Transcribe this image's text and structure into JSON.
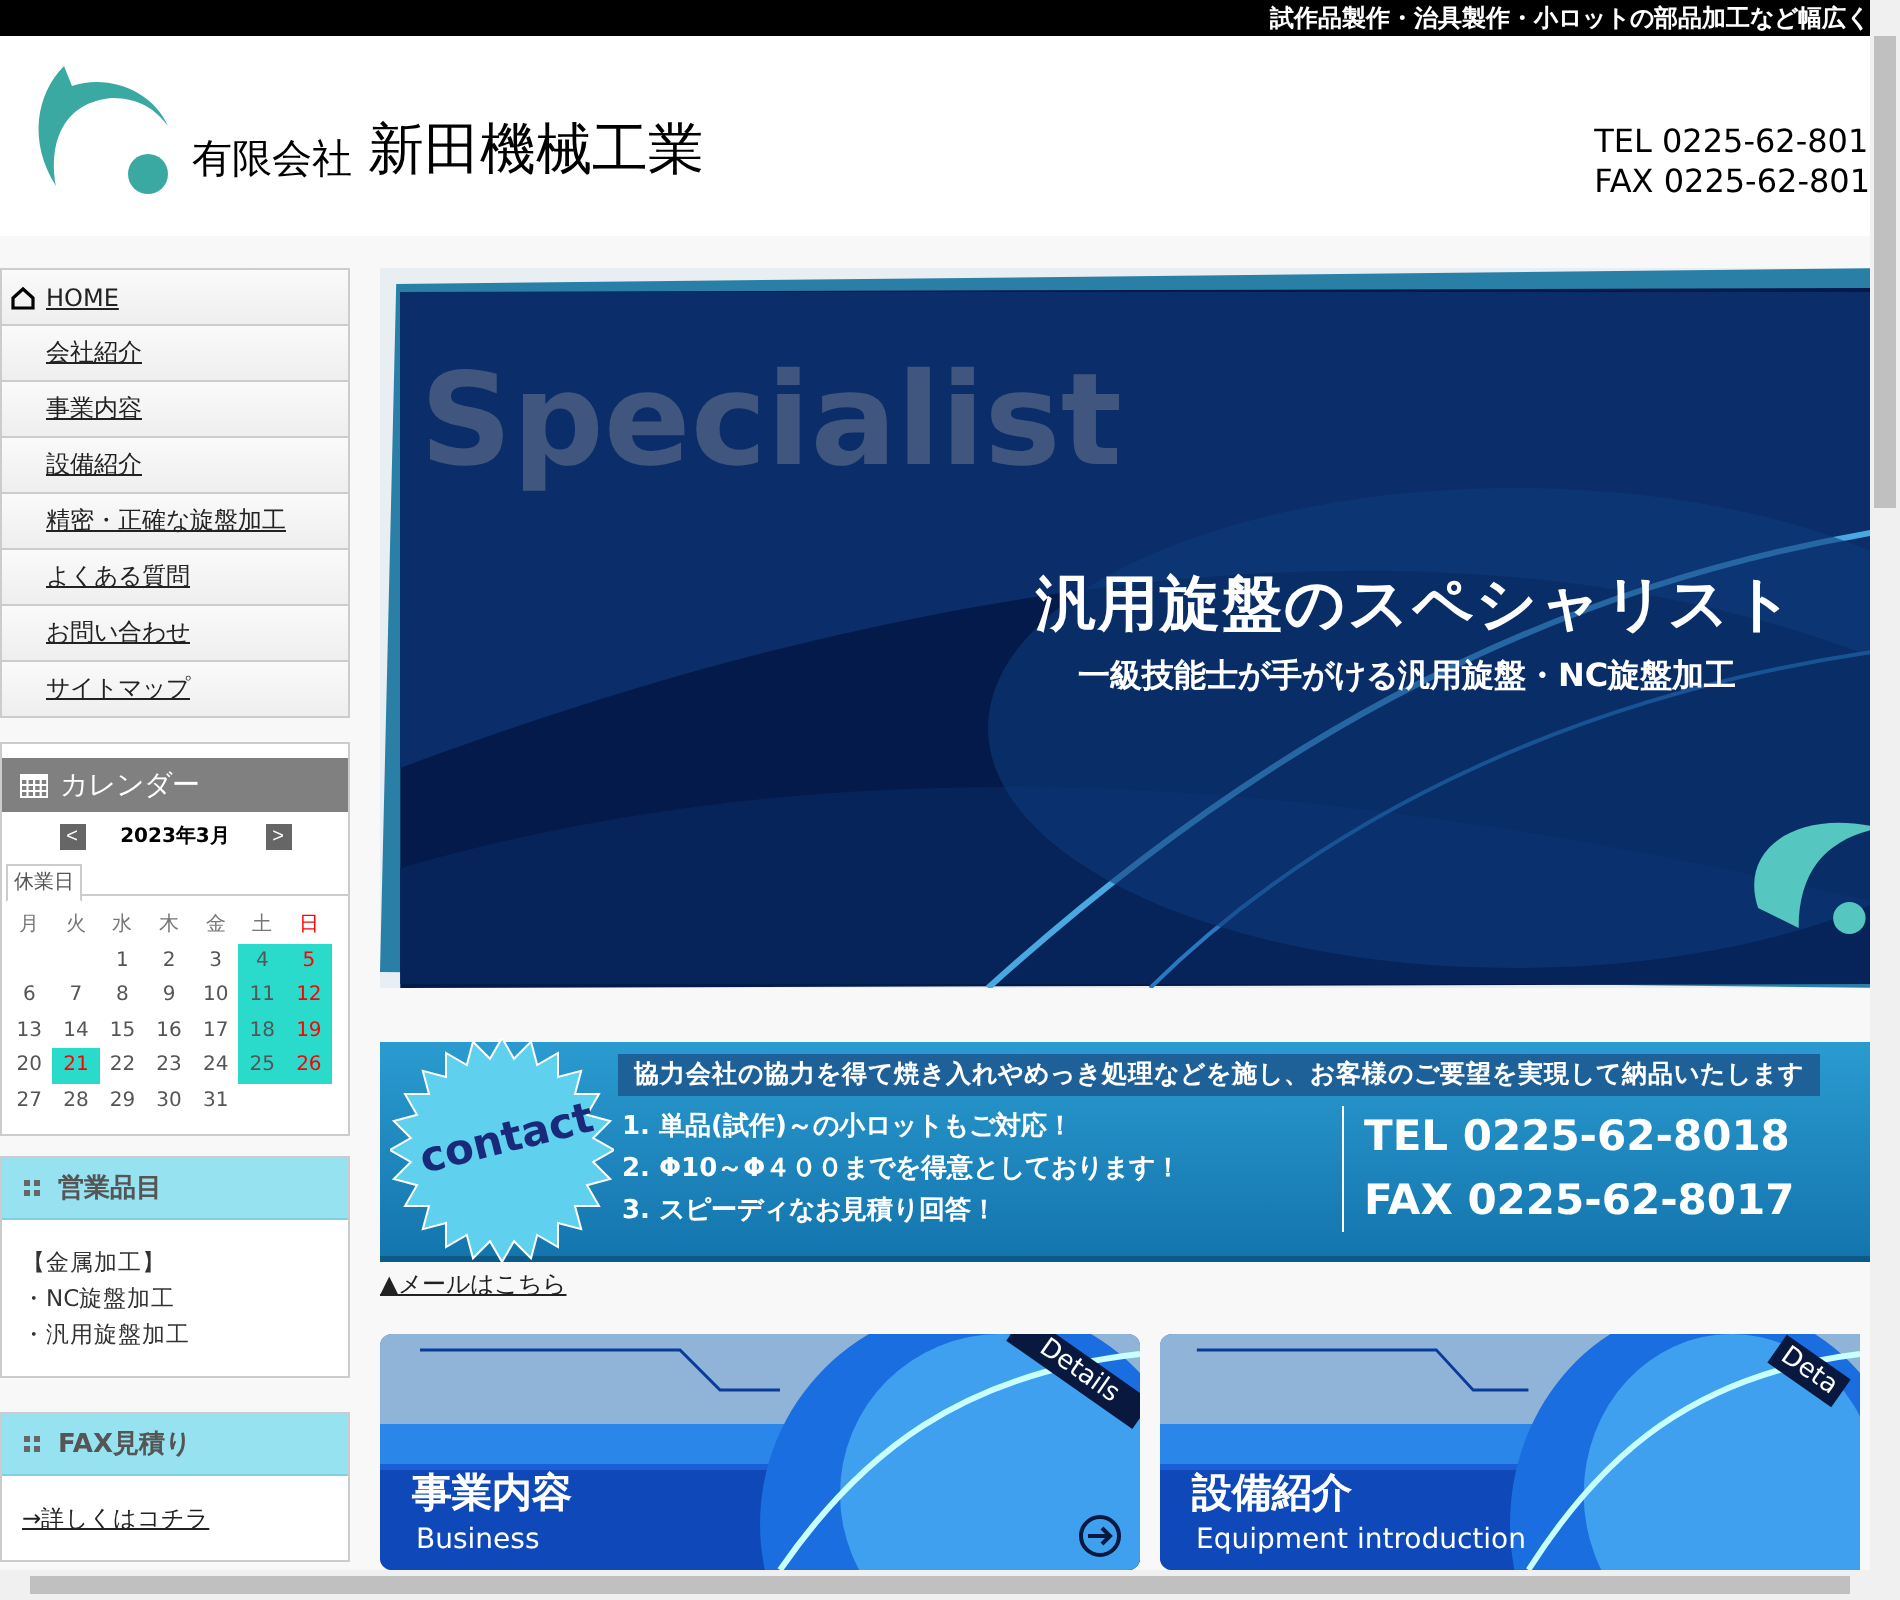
{
  "top_bar": {
    "tagline": "試作品製作・治具製作・小ロットの部品加工など幅広く"
  },
  "header": {
    "company_prefix": "有限会社",
    "company_name": "新田機械工業",
    "tel": "TEL 0225-62-801",
    "fax": "FAX 0225-62-801"
  },
  "nav": [
    {
      "label": "HOME",
      "kind": "home"
    },
    {
      "label": "会社紹介",
      "kind": "page"
    },
    {
      "label": "事業内容",
      "kind": "page"
    },
    {
      "label": "設備紹介",
      "kind": "page"
    },
    {
      "label": "精密・正確な旋盤加工",
      "kind": "page"
    },
    {
      "label": "よくある質問",
      "kind": "page"
    },
    {
      "label": "お問い合わせ",
      "kind": "page"
    },
    {
      "label": "サイトマップ",
      "kind": "page"
    }
  ],
  "calendar": {
    "title": "カレンダー",
    "month": "2023年3月",
    "prev": "<",
    "next": ">",
    "legend": "休業日",
    "weekdays": [
      {
        "label": "月",
        "holiday": false
      },
      {
        "label": "火",
        "holiday": false
      },
      {
        "label": "水",
        "holiday": false
      },
      {
        "label": "木",
        "holiday": false
      },
      {
        "label": "金",
        "holiday": false
      },
      {
        "label": "土",
        "holiday": false
      },
      {
        "label": "日",
        "holiday": true
      }
    ],
    "weeks": [
      [
        {
          "d": "1",
          "closed": false,
          "holiday": false
        },
        {
          "d": "2",
          "closed": false,
          "holiday": false
        },
        {
          "d": "3",
          "closed": false,
          "holiday": false
        },
        {
          "d": "4",
          "closed": true,
          "holiday": false
        },
        {
          "d": "5",
          "closed": true,
          "holiday": true
        }
      ],
      [
        {
          "d": "6",
          "closed": false,
          "holiday": false
        },
        {
          "d": "7",
          "closed": false,
          "holiday": false
        },
        {
          "d": "8",
          "closed": false,
          "holiday": false
        },
        {
          "d": "9",
          "closed": false,
          "holiday": false
        },
        {
          "d": "10",
          "closed": false,
          "holiday": false
        },
        {
          "d": "11",
          "closed": true,
          "holiday": false
        },
        {
          "d": "12",
          "closed": true,
          "holiday": true
        }
      ],
      [
        {
          "d": "13",
          "closed": false,
          "holiday": false
        },
        {
          "d": "14",
          "closed": false,
          "holiday": false
        },
        {
          "d": "15",
          "closed": false,
          "holiday": false
        },
        {
          "d": "16",
          "closed": false,
          "holiday": false
        },
        {
          "d": "17",
          "closed": false,
          "holiday": false
        },
        {
          "d": "18",
          "closed": true,
          "holiday": false
        },
        {
          "d": "19",
          "closed": true,
          "holiday": true
        }
      ],
      [
        {
          "d": "20",
          "closed": false,
          "holiday": false
        },
        {
          "d": "21",
          "closed": true,
          "holiday": true
        },
        {
          "d": "22",
          "closed": false,
          "holiday": false
        },
        {
          "d": "23",
          "closed": false,
          "holiday": false
        },
        {
          "d": "24",
          "closed": false,
          "holiday": false
        },
        {
          "d": "25",
          "closed": true,
          "holiday": false
        },
        {
          "d": "26",
          "closed": true,
          "holiday": true
        }
      ],
      [
        {
          "d": "27",
          "closed": false,
          "holiday": false
        },
        {
          "d": "28",
          "closed": false,
          "holiday": false
        },
        {
          "d": "29",
          "closed": false,
          "holiday": false
        },
        {
          "d": "30",
          "closed": false,
          "holiday": false
        },
        {
          "d": "31",
          "closed": false,
          "holiday": false
        }
      ]
    ]
  },
  "products": {
    "title": "営業品目",
    "lines": [
      "【金属加工】",
      "・NC旋盤加工",
      "・汎用旋盤加工"
    ]
  },
  "fax_quote": {
    "title": "FAX見積り",
    "link": "→詳しくはコチラ"
  },
  "hero": {
    "word": "Specialist",
    "headline": "汎用旋盤のスペシャリスト",
    "subline": "一級技能士が手がける汎用旋盤・NC旋盤加工"
  },
  "contact": {
    "badge": "contact",
    "strip": "協力会社の協力を得て焼き入れやめっき処理などを施し、お客様のご要望を実現して納品いたします",
    "points": [
      "1.  単品(試作)～の小ロットもご対応！",
      "2.  Φ10～Φ４００までを得意としております！",
      "3.  スピーディなお見積り回答！"
    ],
    "tel": "TEL 0225-62-8018",
    "fax": "FAX 0225-62-8017"
  },
  "mail_link": "▲メールはこちら",
  "cards": [
    {
      "title": "事業内容",
      "subtitle": "Business",
      "ribbon": "Details",
      "arrow": true
    },
    {
      "title": "設備紹介",
      "subtitle": "Equipment introduction",
      "ribbon": "Deta",
      "arrow": false
    }
  ]
}
